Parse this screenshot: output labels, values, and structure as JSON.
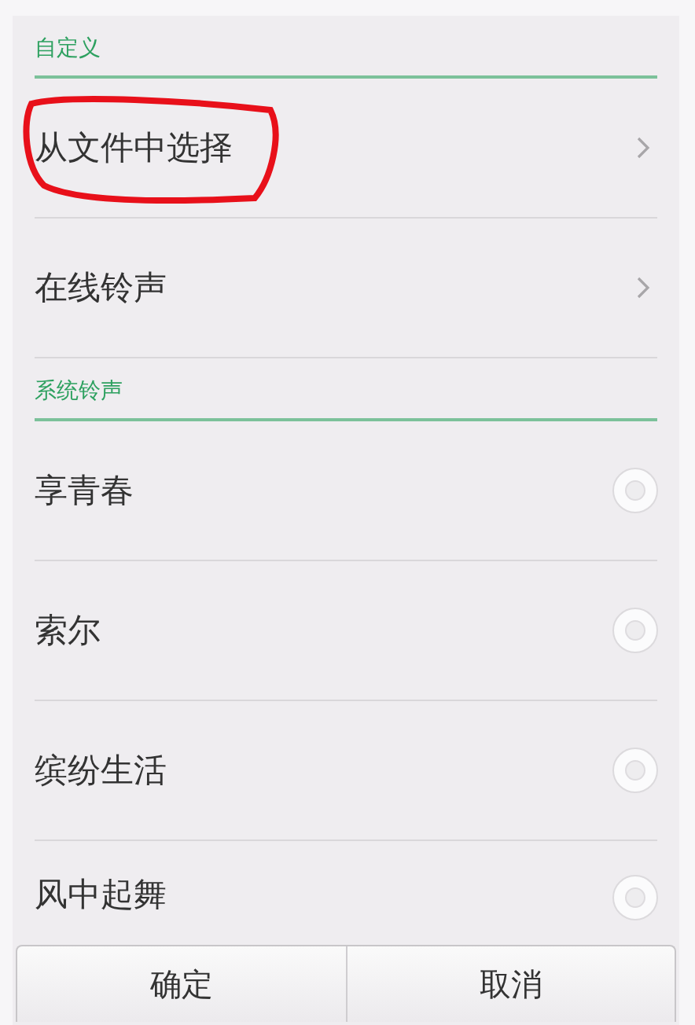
{
  "sections": [
    {
      "title": "自定义",
      "items": [
        {
          "kind": "link",
          "label": "从文件中选择",
          "annotated": true
        },
        {
          "kind": "link",
          "label": "在线铃声",
          "annotated": false
        }
      ]
    },
    {
      "title": "系统铃声",
      "items": [
        {
          "kind": "radio",
          "label": "享青春",
          "selected": false
        },
        {
          "kind": "radio",
          "label": "索尔",
          "selected": false
        },
        {
          "kind": "radio",
          "label": "缤纷生活",
          "selected": false
        },
        {
          "kind": "radio",
          "label": "风中起舞",
          "selected": false
        }
      ]
    }
  ],
  "buttons": [
    "确定",
    "取消"
  ]
}
